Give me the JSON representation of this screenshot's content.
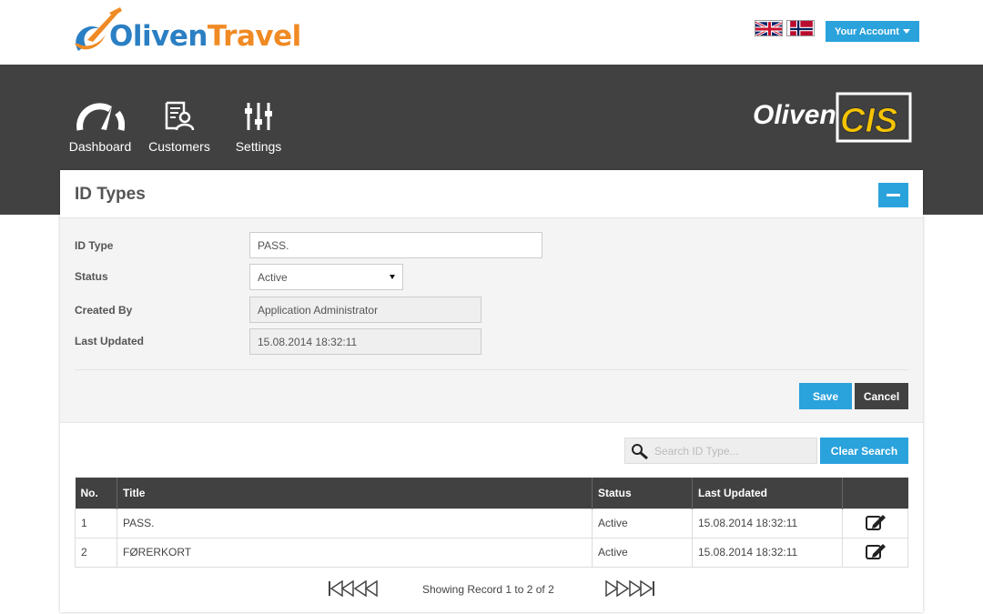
{
  "header": {
    "logo_part1": "Oliven",
    "logo_part2": "Travel",
    "account_label": "Your Account",
    "colors": {
      "accent": "#2aa2dc",
      "dark": "#414141",
      "logo_blue": "#2b7fc3",
      "logo_orange": "#f08a24"
    }
  },
  "nav": {
    "items": [
      {
        "label": "Dashboard",
        "icon": "speedometer-icon"
      },
      {
        "label": "Customers",
        "icon": "customer-document-icon"
      },
      {
        "label": "Settings",
        "icon": "sliders-icon"
      }
    ],
    "brand_part1": "Oliven",
    "brand_part2": "CIS"
  },
  "panel": {
    "title": "ID Types",
    "form": {
      "id_type_label": "ID Type",
      "id_type_value": "PASS.",
      "status_label": "Status",
      "status_value": "Active",
      "created_by_label": "Created By",
      "created_by_value": "Application Administrator",
      "last_updated_label": "Last Updated",
      "last_updated_value": "15.08.2014 18:32:11",
      "save_label": "Save",
      "cancel_label": "Cancel"
    },
    "search": {
      "placeholder": "Search ID Type...",
      "clear_label": "Clear Search"
    },
    "table": {
      "columns": [
        "No.",
        "Title",
        "Status",
        "Last Updated",
        ""
      ],
      "rows": [
        {
          "no": "1",
          "title": "PASS.",
          "status": "Active",
          "updated": "15.08.2014 18:32:11"
        },
        {
          "no": "2",
          "title": "FØRERKORT",
          "status": "Active",
          "updated": "15.08.2014 18:32:11"
        }
      ]
    },
    "pager": {
      "info": "Showing Record 1 to 2 of 2"
    }
  }
}
